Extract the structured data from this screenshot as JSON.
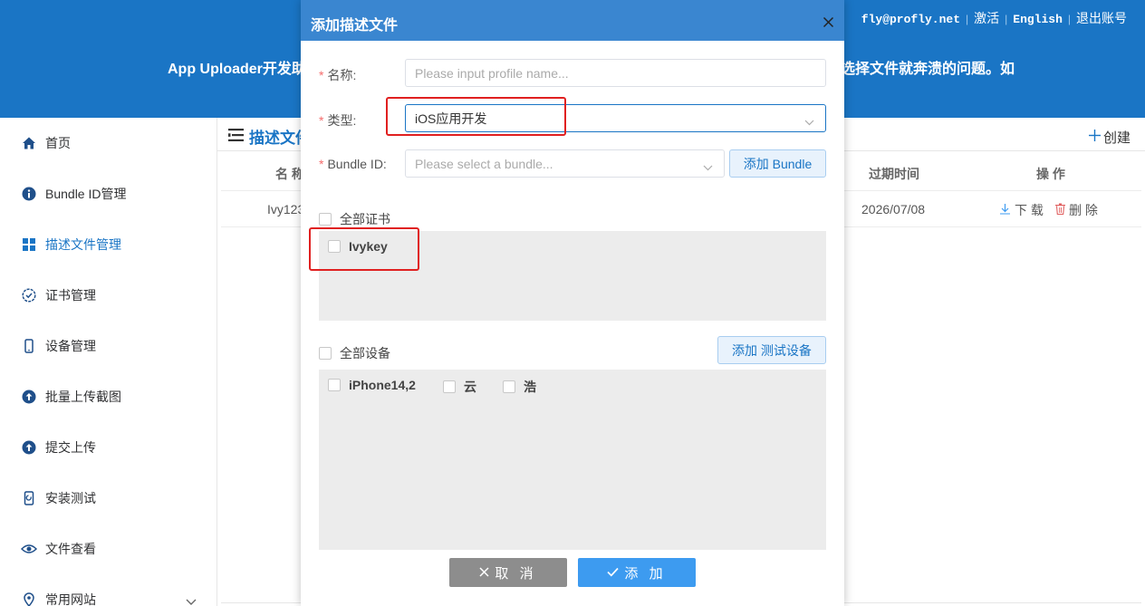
{
  "header": {
    "email": "fly@profly.net",
    "activate": "激活",
    "language": "English",
    "logout": "退出账号",
    "banner_left": "App Uploader开发助",
    "banner_right": "选择文件就奔溃的问题。如"
  },
  "sidebar": {
    "items": [
      {
        "label": "首页",
        "icon": "home-icon"
      },
      {
        "label": "Bundle ID管理",
        "icon": "info-icon"
      },
      {
        "label": "描述文件管理",
        "icon": "grid-icon"
      },
      {
        "label": "证书管理",
        "icon": "certificate-icon"
      },
      {
        "label": "设备管理",
        "icon": "phone-icon"
      },
      {
        "label": "批量上传截图",
        "icon": "upload-circle-icon"
      },
      {
        "label": "提交上传",
        "icon": "upload-circle-icon"
      },
      {
        "label": "安装测试",
        "icon": "install-icon"
      },
      {
        "label": "文件查看",
        "icon": "eye-icon"
      },
      {
        "label": "常用网站",
        "icon": "location-icon"
      }
    ]
  },
  "main": {
    "title": "描述文件",
    "create": "创建",
    "columns": {
      "name": "名 称",
      "expire": "过期时间",
      "action": "操 作"
    },
    "row": {
      "name": "Ivy123",
      "expire": "2026/07/08",
      "download": "下 载",
      "delete": "删 除"
    }
  },
  "dialog": {
    "title": "添加描述文件",
    "name_label": "名称:",
    "name_placeholder": "Please input profile name...",
    "type_label": "类型:",
    "type_value": "iOS应用开发",
    "bundle_label": "Bundle ID:",
    "bundle_placeholder": "Please select a bundle...",
    "add_bundle": "添加 Bundle",
    "all_certs": "全部证书",
    "certs": [
      "Ivykey"
    ],
    "all_devices": "全部设备",
    "add_device": "添加 测试设备",
    "devices": [
      "iPhone14,2",
      "云",
      "浩"
    ],
    "cancel": "取 消",
    "add": "添 加"
  },
  "colors": {
    "brand": "#1a75c5",
    "dialog_header": "#3a86d0",
    "highlight": "#e02020",
    "primary_button": "#3d9bf0"
  }
}
